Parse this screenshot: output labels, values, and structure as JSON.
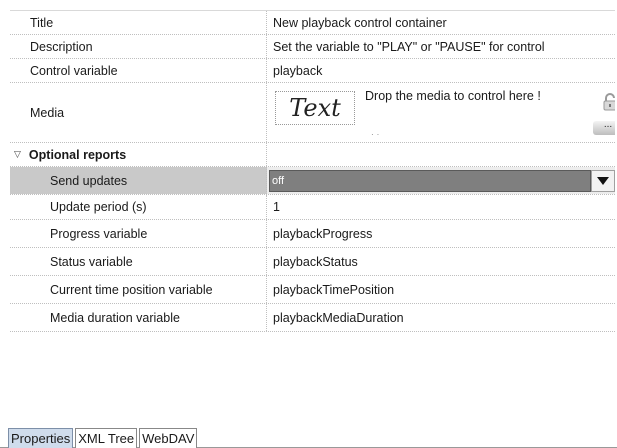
{
  "properties": {
    "title": {
      "label": "Title",
      "value": "New playback control container"
    },
    "description": {
      "label": "Description",
      "value": "Set the variable to \"PLAY\" or \"PAUSE\" for control"
    },
    "control_variable": {
      "label": "Control variable",
      "value": "playback"
    },
    "media": {
      "label": "Media",
      "preview_text": "Text",
      "drop_hint": "Drop the media to control here !",
      "more_label": "...",
      "lock_icon": "lock-icon"
    },
    "optional_reports": {
      "label": "Optional reports",
      "caret_icon": "collapse-triangle-icon",
      "send_updates": {
        "label": "Send updates",
        "value": "off"
      },
      "update_period": {
        "label": "Update period (s)",
        "value": "1"
      },
      "progress_variable": {
        "label": "Progress variable",
        "value": "playbackProgress"
      },
      "status_variable": {
        "label": "Status variable",
        "value": "playbackStatus"
      },
      "current_time_position_variable": {
        "label": "Current time position variable",
        "value": "playbackTimePosition"
      },
      "media_duration_variable": {
        "label": "Media duration variable",
        "value": "playbackMediaDuration"
      }
    }
  },
  "tabs": [
    {
      "label": "Properties",
      "active": true
    },
    {
      "label": "XML Tree",
      "active": false
    },
    {
      "label": "WebDAV",
      "active": false
    }
  ],
  "colors": {
    "selected_row": "#c9c9c9",
    "dropdown_fill": "#7f7f7f",
    "active_tab": "#cfdcec"
  }
}
